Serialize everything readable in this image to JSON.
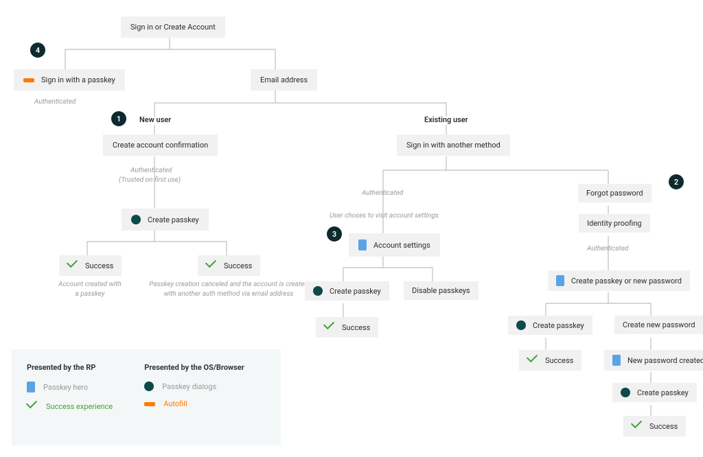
{
  "root": {
    "label": "Sign in or Create Account"
  },
  "passkey_signin": {
    "label": "Sign in with a passkey",
    "caption": "Authenticated"
  },
  "email": {
    "label": "Email address"
  },
  "new_user": {
    "label": "New user",
    "confirm": {
      "label": "Create account confirmation"
    },
    "caption_auth": "Authenticated",
    "caption_trusted": "(Trusted on first use)",
    "create_passkey": {
      "label": "Create passkey"
    },
    "success_left": {
      "label": "Success",
      "caption_l1": "Account created with",
      "caption_l2": "a passkey"
    },
    "success_right": {
      "label": "Success",
      "caption_l1": "Passkey creation canceled and the account is created",
      "caption_l2": "with another auth method via email address"
    }
  },
  "existing_user": {
    "label": "Existing user",
    "signin_other": {
      "label": "Sign in with another method"
    },
    "caption_auth": "Authenticated",
    "caption_visit": "User choses to visit account settings",
    "account_settings": {
      "label": "Account settings"
    },
    "create_passkey": {
      "label": "Create passkey"
    },
    "disable_passkeys": {
      "label": "Disable passkeys"
    },
    "success": {
      "label": "Success"
    }
  },
  "forgot": {
    "label": "Forgot password",
    "identity": {
      "label": "Identity proofing"
    },
    "caption_auth": "Authenticated",
    "choose": {
      "label": "Create passkey or new password"
    },
    "create_passkey": {
      "label": "Create passkey"
    },
    "create_new_pw": {
      "label": "Create new password"
    },
    "success_pk": {
      "label": "Success"
    },
    "new_pw_created": {
      "label": "New password created"
    },
    "create_passkey2": {
      "label": "Create passkey"
    },
    "success_final": {
      "label": "Success"
    }
  },
  "badges": {
    "b1": "1",
    "b2": "2",
    "b3": "3",
    "b4": "4"
  },
  "legend": {
    "rp_title": "Presented by the RP",
    "os_title": "Presented by the OS/Browser",
    "hero": "Passkey hero",
    "success": "Success experience",
    "dialogs": "Passkey dialogs",
    "autofill": "Autofill"
  }
}
